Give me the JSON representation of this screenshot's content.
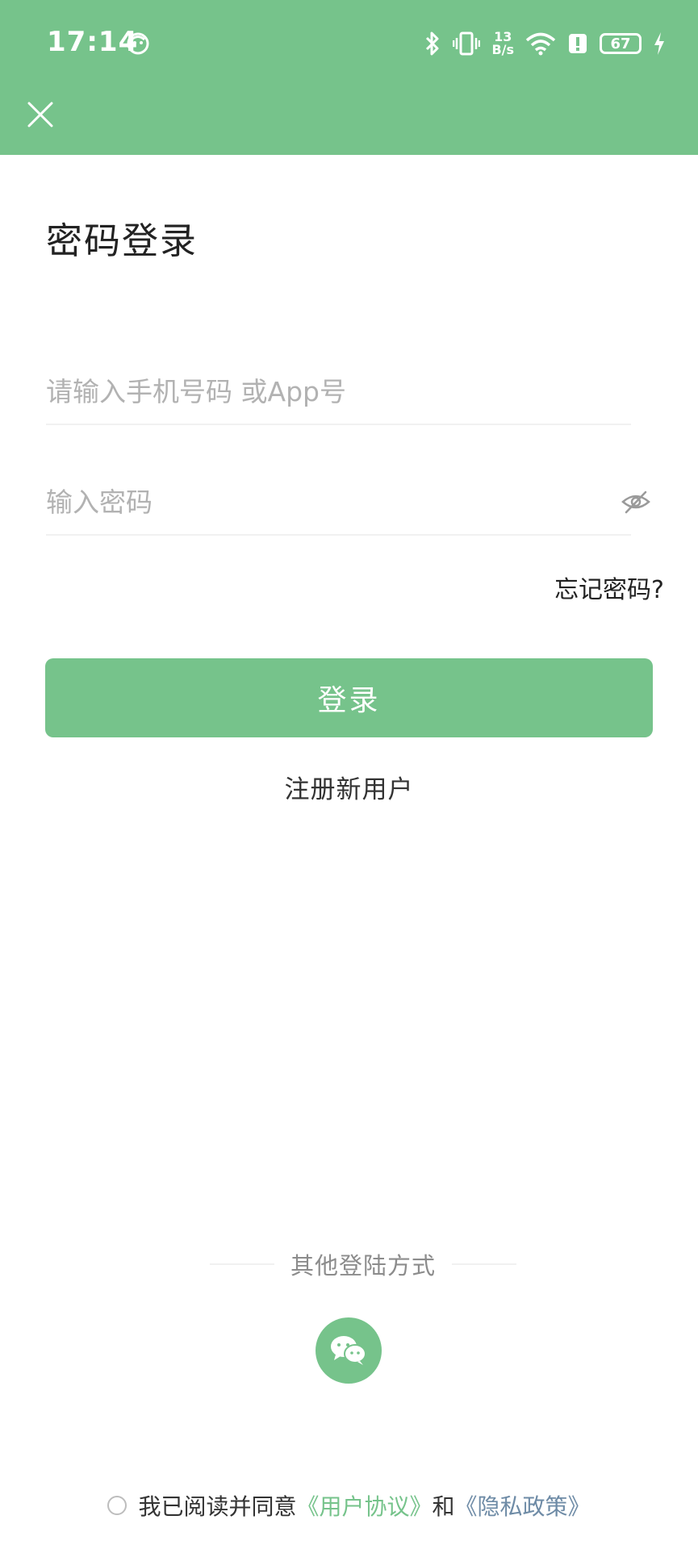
{
  "status_bar": {
    "time": "17:14",
    "net_speed_value": "13",
    "net_speed_unit": "B/s",
    "battery_level": "67"
  },
  "page": {
    "title": "密码登录"
  },
  "form": {
    "phone_placeholder": "请输入手机号码 或App号",
    "password_placeholder": "输入密码",
    "forgot_password": "忘记密码?",
    "login_button": "登录",
    "register": "注册新用户"
  },
  "other_login": {
    "label": "其他登陆方式"
  },
  "agreement": {
    "prefix": "我已阅读并同意",
    "user_agreement": "《用户协议》",
    "connector": "和",
    "privacy_policy": "《隐私政策》"
  },
  "colors": {
    "accent": "#76c38b",
    "link_blue": "#6e8ba6",
    "placeholder": "#b2b2b2"
  }
}
